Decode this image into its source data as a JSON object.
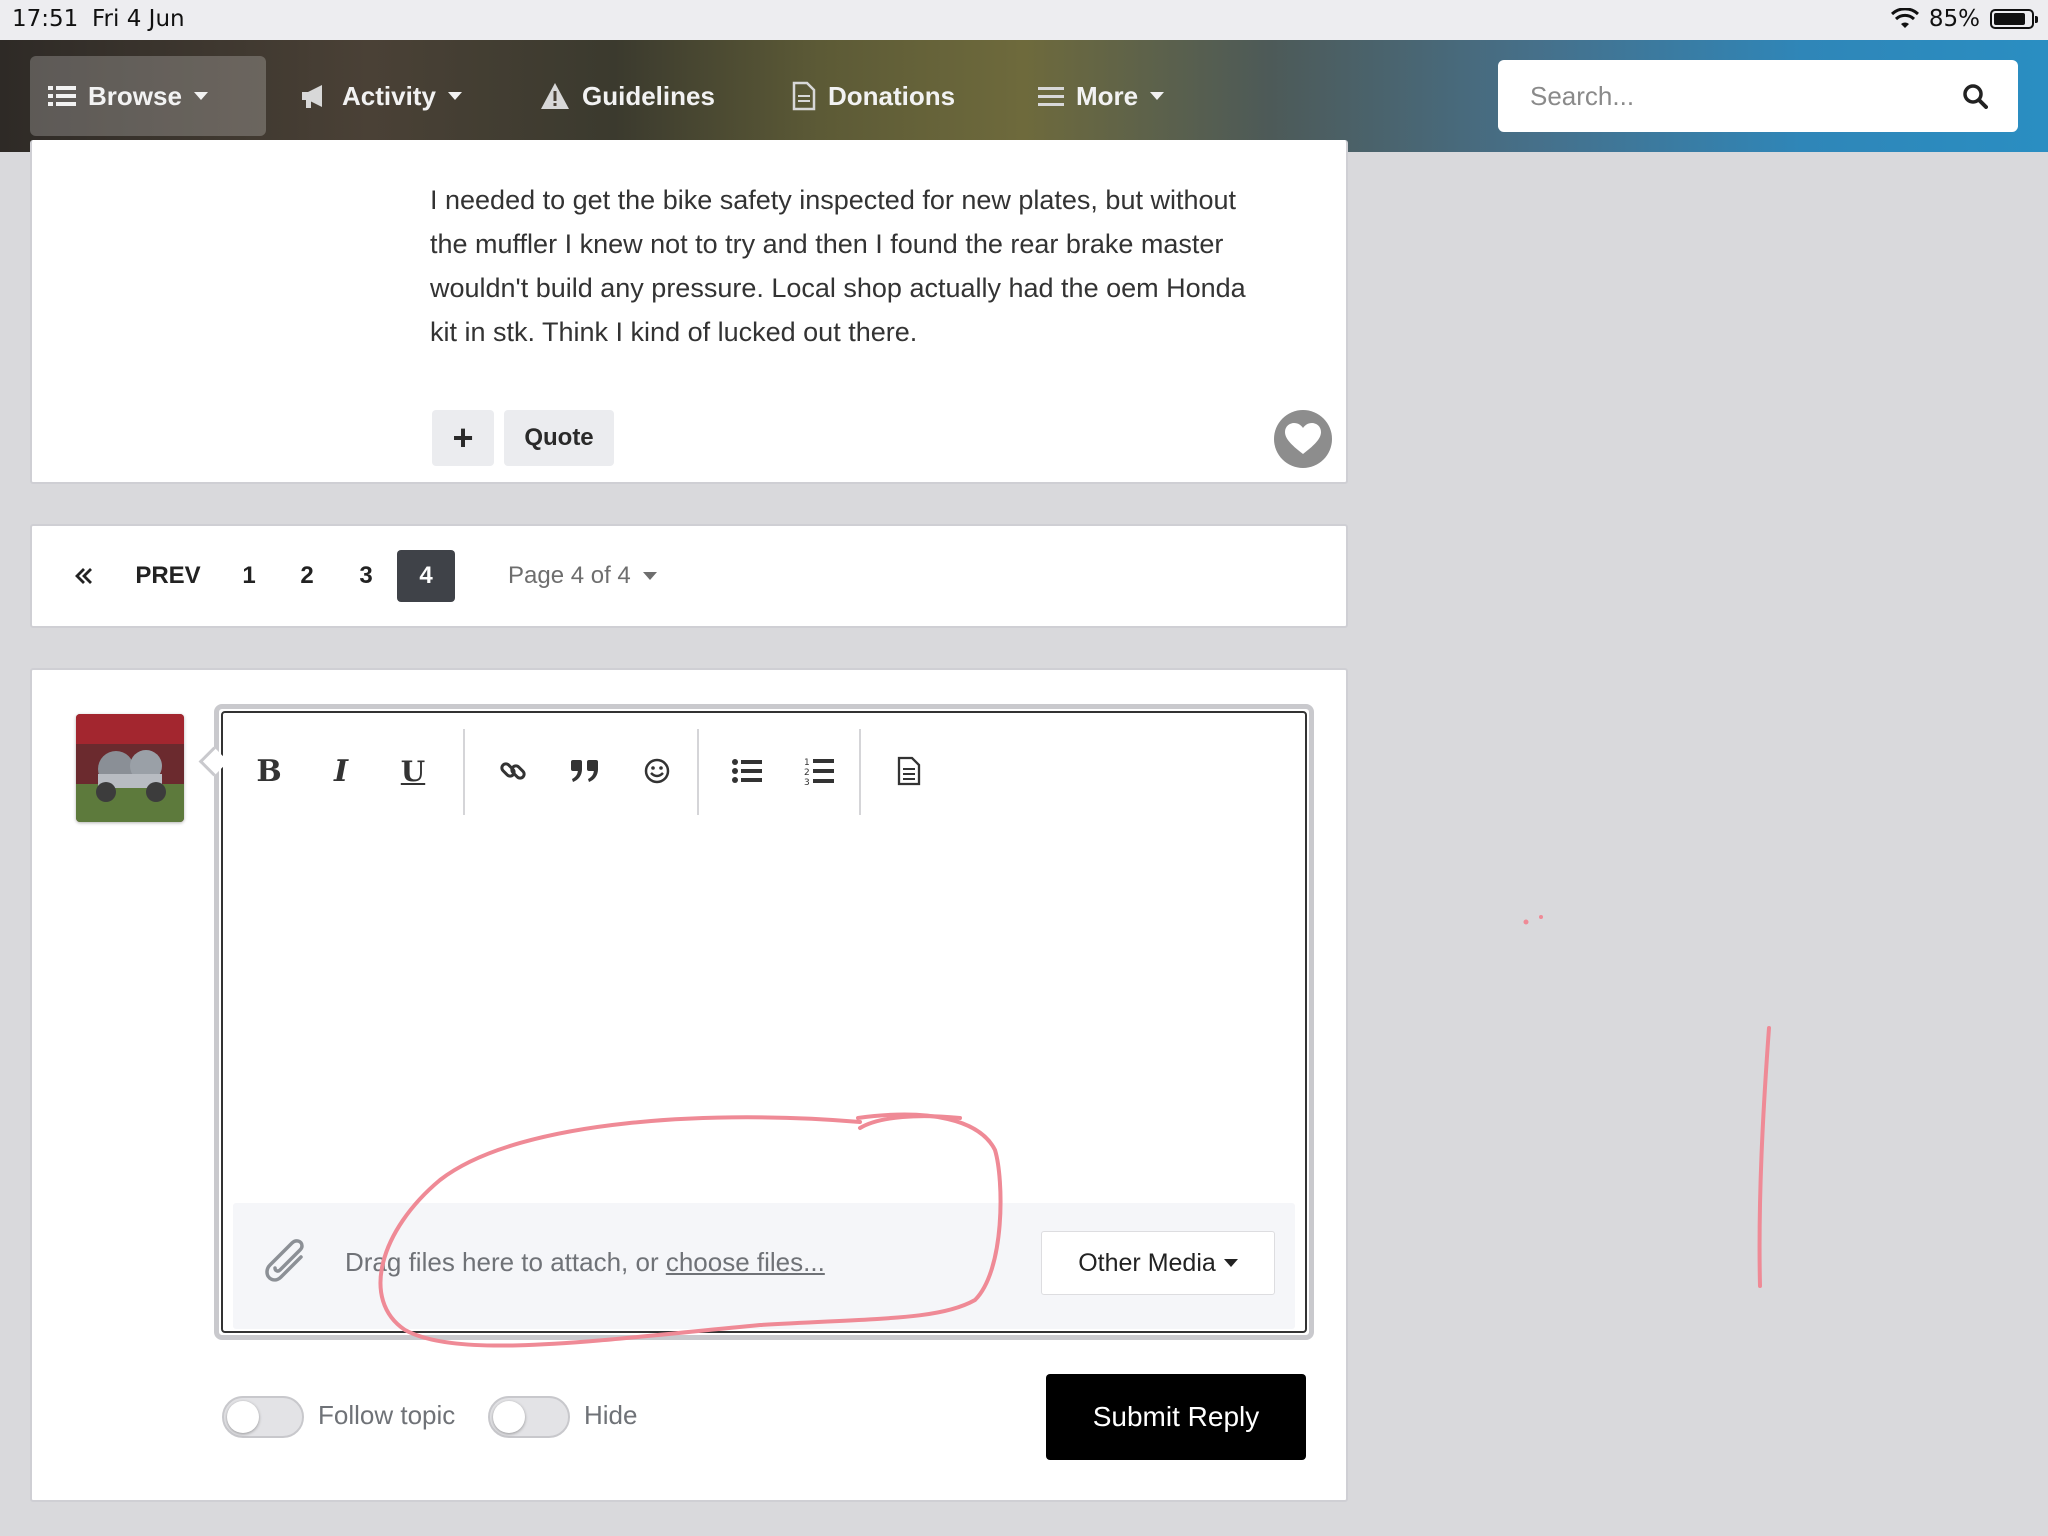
{
  "status_bar": {
    "time": "17:51",
    "date": "Fri 4 Jun",
    "battery_percent": "85%",
    "battery_level": 0.85
  },
  "nav": {
    "items": [
      {
        "label": "Browse",
        "icon": "list-icon"
      },
      {
        "label": "Activity",
        "icon": "megaphone-icon"
      },
      {
        "label": "Guidelines",
        "icon": "warning-icon"
      },
      {
        "label": "Donations",
        "icon": "document-icon"
      },
      {
        "label": "More",
        "icon": "menu-icon"
      }
    ],
    "search_placeholder": "Search..."
  },
  "post": {
    "lines": [
      "I needed to get the bike safety inspected for new plates, but without",
      "the muffler I knew not to try and then I found the rear brake master",
      "wouldn't build any pressure. Local shop actually had the oem Honda",
      "kit in stk. Think I kind of lucked out there."
    ],
    "plus_label": "+",
    "quote_label": "Quote"
  },
  "pagination": {
    "prev_label": "PREV",
    "pages": [
      "1",
      "2",
      "3",
      "4"
    ],
    "current_page": "4",
    "page_label": "Page 4 of 4"
  },
  "editor": {
    "toolbar": [
      "bold",
      "italic",
      "underline",
      "link",
      "quote",
      "emoji",
      "bullet-list",
      "numbered-list",
      "source"
    ],
    "bold_label": "B",
    "italic_label": "I",
    "underline_label": "U",
    "attach_text": "Drag files here to attach, or ",
    "choose_files_label": "choose files...",
    "other_media_label": "Other Media"
  },
  "footer": {
    "follow_topic_label": "Follow topic",
    "hide_label": "Hide",
    "submit_label": "Submit Reply"
  },
  "colors": {
    "annotation": "#ef8a96",
    "active_page_bg": "#3f4248",
    "submit_bg": "#000000"
  }
}
